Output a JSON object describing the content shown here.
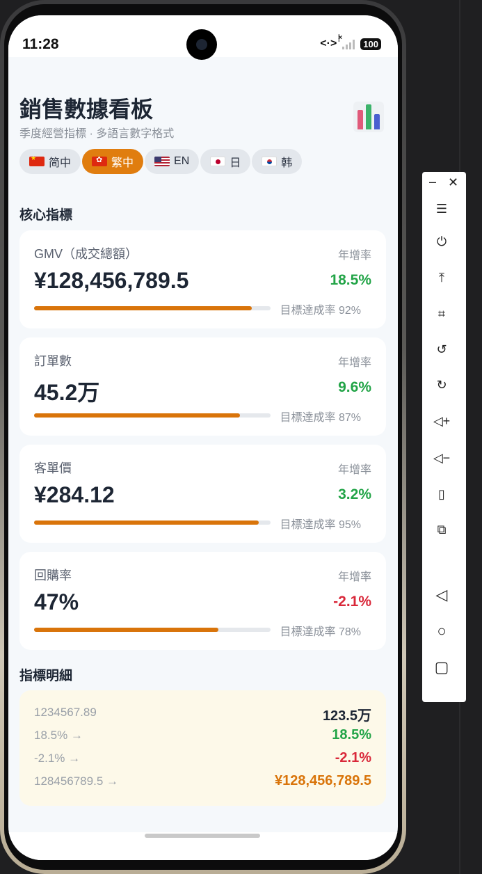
{
  "status_bar": {
    "time": "11:28",
    "battery": "100"
  },
  "header": {
    "title": "銷售數據看板",
    "subtitle": "季度經營指標 · 多語言數字格式"
  },
  "languages": [
    {
      "label": "简中",
      "flag": "cn-flag-icon",
      "active": false
    },
    {
      "label": "繁中",
      "flag": "hk-flag-icon",
      "active": true
    },
    {
      "label": "EN",
      "flag": "us-flag-icon",
      "active": false
    },
    {
      "label": "日",
      "flag": "jp-flag-icon",
      "active": false
    },
    {
      "label": "韩",
      "flag": "kr-flag-icon",
      "active": false
    }
  ],
  "core_section": {
    "title": "核心指標"
  },
  "metrics": [
    {
      "name": "GMV（成交總額）",
      "growth_label": "年增率",
      "value": "¥128,456,789.5",
      "growth": "18.5%",
      "growth_positive": true,
      "progress_text": "目標達成率 92%",
      "progress": 0.92
    },
    {
      "name": "訂單數",
      "growth_label": "年增率",
      "value": "45.2万",
      "growth": "9.6%",
      "growth_positive": true,
      "progress_text": "目標達成率 87%",
      "progress": 0.87
    },
    {
      "name": "客單價",
      "growth_label": "年增率",
      "value": "¥284.12",
      "growth": "3.2%",
      "growth_positive": true,
      "progress_text": "目標達成率 95%",
      "progress": 0.95
    },
    {
      "name": "回購率",
      "growth_label": "年增率",
      "value": "47%",
      "growth": "-2.1%",
      "growth_positive": false,
      "progress_text": "目標達成率 78%",
      "progress": 0.78
    }
  ],
  "detail_section": {
    "title": "指標明細",
    "rows": [
      {
        "input": "1234567.89",
        "output": "123.5万",
        "color": "dark"
      },
      {
        "input": "18.5% →",
        "output": "18.5%",
        "color": "green"
      },
      {
        "input": "-2.1% →",
        "output": "-2.1%",
        "color": "red"
      },
      {
        "input": "128456789.5 →",
        "output": "¥128,456,789.5",
        "color": "orange"
      }
    ]
  },
  "colors": {
    "accent": "#e07d0f",
    "progress": "#d9740a",
    "positive": "#22a447",
    "negative": "#d9283a"
  },
  "side_toolbar": {
    "buttons": [
      "menu-icon",
      "power-icon",
      "pin-top-icon",
      "crop-icon",
      "rotate-left-icon",
      "rotate-right-icon",
      "volume-up-icon",
      "volume-down-icon",
      "shake-icon",
      "screenshot-icon",
      "back-icon",
      "home-icon",
      "recents-icon"
    ]
  }
}
